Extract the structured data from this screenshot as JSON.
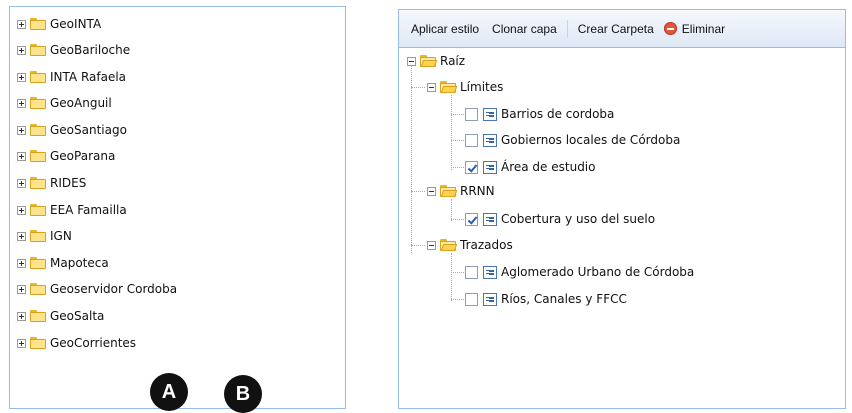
{
  "panel_a": {
    "items": [
      {
        "label": "GeoINTA"
      },
      {
        "label": "GeoBariloche"
      },
      {
        "label": "INTA Rafaela"
      },
      {
        "label": "GeoAnguil"
      },
      {
        "label": "GeoSantiago"
      },
      {
        "label": "GeoParana"
      },
      {
        "label": "RIDES"
      },
      {
        "label": "EEA Famailla"
      },
      {
        "label": "IGN"
      },
      {
        "label": "Mapoteca"
      },
      {
        "label": "Geoservidor Cordoba"
      },
      {
        "label": "GeoSalta"
      },
      {
        "label": "GeoCorrientes"
      }
    ],
    "badge": "A"
  },
  "panel_b": {
    "toolbar": {
      "apply_style": "Aplicar estilo",
      "clone_layer": "Clonar capa",
      "create_folder": "Crear Carpeta",
      "delete": "Eliminar"
    },
    "root": {
      "label": "Raíz",
      "groups": [
        {
          "label": "Límites",
          "layers": [
            {
              "label": "Barrios de cordoba",
              "checked": false
            },
            {
              "label": "Gobiernos locales de Córdoba",
              "checked": false
            },
            {
              "label": "Área de estudio",
              "checked": true
            }
          ]
        },
        {
          "label": "RRNN",
          "layers": [
            {
              "label": "Cobertura y uso del suelo",
              "checked": true
            }
          ]
        },
        {
          "label": "Trazados",
          "layers": [
            {
              "label": "Aglomerado Urbano de Córdoba",
              "checked": false
            },
            {
              "label": "Ríos, Canales y FFCC",
              "checked": false
            }
          ]
        }
      ]
    },
    "badge": "B"
  },
  "icons": {
    "collapsed": "plus-expander-icon",
    "expanded": "minus-expander-icon",
    "folder": "folder-icon",
    "layer": "layer-icon",
    "delete": "delete-icon"
  }
}
